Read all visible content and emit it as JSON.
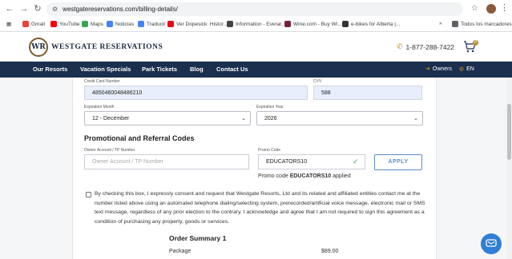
{
  "browser": {
    "url": "westgatereservations.com/billing-details/",
    "bookmarks": [
      {
        "label": "Gmail",
        "color": "#ea4335"
      },
      {
        "label": "YouTube",
        "color": "#ff0000"
      },
      {
        "label": "Maps",
        "color": "#34a853"
      },
      {
        "label": "Noticias",
        "color": "#4285f4"
      },
      {
        "label": "Traducir",
        "color": "#4285f4"
      },
      {
        "label": "Ver Dopesick: Histor...",
        "color": "#e50914"
      },
      {
        "label": "Information - Everar...",
        "color": "#444444"
      },
      {
        "label": "Wine.com - Buy Wi...",
        "color": "#7b1e3a"
      },
      {
        "label": "e-bikes for Alberta |...",
        "color": "#333333"
      }
    ],
    "bookmarks_more": "»",
    "all_bookmarks": "Todos los marcadores"
  },
  "header": {
    "logo_initials": "WR",
    "brand": "WESTGATE RESERVATIONS",
    "phone": "1-877-288-7422",
    "cart_count": "0"
  },
  "nav": {
    "items": [
      "Our Resorts",
      "Vacation Specials",
      "Park Tickets",
      "Blog",
      "Contact Us"
    ],
    "owners": "Owners",
    "language": "EN"
  },
  "form": {
    "card_number_label": "Credit Card Number",
    "card_number": "4850460048486210",
    "cvv_label": "CVV",
    "cvv": "588",
    "exp_month_label": "Expiration Month",
    "exp_month": "12 - December",
    "exp_year_label": "Expiration Year",
    "exp_year": "2026",
    "promo_section_title": "Promotional and Referral Codes",
    "owner_account_label": "Owner Account / TP Number",
    "owner_account_placeholder": "Owner Account / TP Number",
    "promo_code_label": "Promo Code",
    "promo_code": "EDUCATORS10",
    "apply_label": "APPLY",
    "promo_note_prefix": "Promo code",
    "promo_note_code": "EDUCATORS10",
    "promo_note_suffix": "applied",
    "consent_text": "By checking this box, I expressly consent and request that Westgate Resorts, Ltd and its related and affiliated entities contact me at the number listed above using an automated telephone dialing/selecting system, prerecorded/artificial voice message, electronic mail or SMS text message, regardless of any prior election to the contrary. I acknowledge and agree that I am not required to sign this agreement as a condition of purchasing any property, goods or services."
  },
  "order": {
    "title": "Order Summary 1",
    "rows": [
      {
        "label": "Package",
        "value": "$89.00"
      }
    ]
  },
  "colors": {
    "navbar": "#1b2f4e",
    "accent_gold": "#c48a2e",
    "apply_blue": "#5b8cc8",
    "chat_blue": "#2f7fd6",
    "success_green": "#2e9e5a"
  }
}
